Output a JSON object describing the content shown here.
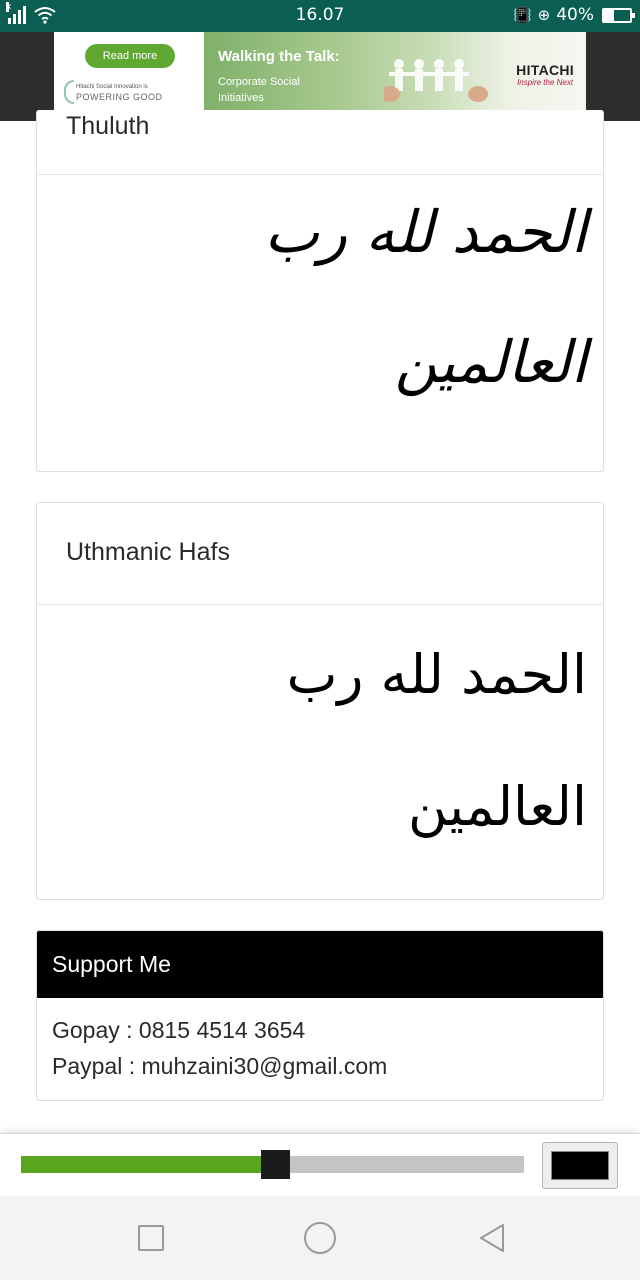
{
  "status_bar": {
    "time": "16.07",
    "battery_percent": "40%",
    "battery_level": 0.4,
    "icons": [
      "no-sim-signal-icon",
      "wifi-icon",
      "vibrate-icon",
      "data-saver-icon",
      "battery-icon"
    ]
  },
  "ad": {
    "button_label": "Read more",
    "logo_small": "Hitachi Social Innovation is",
    "logo_big": "POWERING GOOD",
    "headline": "Walking the Talk:",
    "subline": "Corporate Social Initiatives",
    "brand_name": "HITACHI",
    "brand_tagline": "Inspire the Next"
  },
  "cards": [
    {
      "title": "Thuluth",
      "arabic_line1": "الحمد لله رب",
      "arabic_line2": "العالمين"
    },
    {
      "title": "Uthmanic Hafs",
      "arabic_line1": "الحمد لله رب",
      "arabic_line2": "العالمين"
    }
  ],
  "support": {
    "title": "Support Me",
    "gopay": "Gopay : 0815 4514 3654",
    "paypal": "Paypal : muhzaini30@gmail.com"
  },
  "player": {
    "progress": 0.5,
    "color_value": "#000000",
    "accent_color": "#5aa51e"
  },
  "nav": {
    "icons": [
      "recent-apps-icon",
      "home-icon",
      "back-icon"
    ]
  }
}
